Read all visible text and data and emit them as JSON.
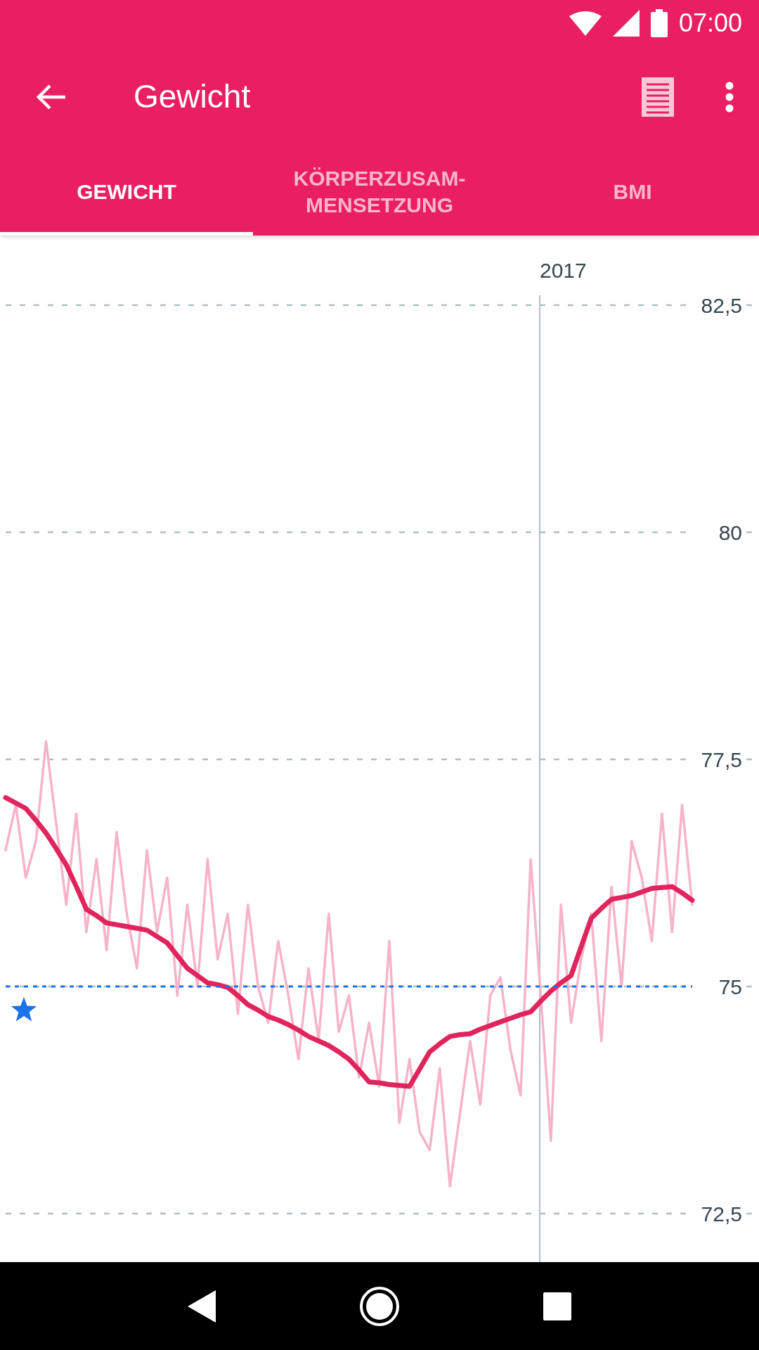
{
  "status_bar": {
    "time": "07:00"
  },
  "toolbar": {
    "title": "Gewicht"
  },
  "tabs": [
    {
      "label": "GEWICHT",
      "selected": true
    },
    {
      "label": "KÖRPERZUSAM-MENSETZUNG",
      "selected": false
    },
    {
      "label": "BMI",
      "selected": false
    }
  ],
  "chart": {
    "chart_data": {
      "type": "line",
      "grid": true,
      "yticks": [
        {
          "value": 82.5,
          "label": "82,5"
        },
        {
          "value": 80,
          "label": "80"
        },
        {
          "value": 77.5,
          "label": "77,5"
        },
        {
          "value": 75,
          "label": "75"
        },
        {
          "value": 72.5,
          "label": "72,5"
        }
      ],
      "series": [
        {
          "color": "#f6b3ca",
          "values": [
            76.5,
            77.0,
            76.2,
            76.6,
            77.7,
            76.8,
            75.9,
            76.9,
            75.6,
            76.4,
            75.4,
            76.7,
            75.8,
            75.2,
            76.5,
            75.6,
            76.2,
            74.9,
            75.9,
            75.0,
            76.4,
            75.3,
            75.8,
            74.7,
            75.9,
            75.0,
            74.6,
            75.5,
            74.9,
            74.2,
            75.2,
            74.4,
            75.8,
            74.5,
            74.9,
            74.0,
            74.6,
            73.9,
            75.5,
            73.5,
            74.2,
            73.4,
            73.2,
            74.1,
            72.8,
            73.6,
            74.4,
            73.7,
            74.9,
            75.1,
            74.3,
            73.8,
            76.4,
            74.9,
            73.3,
            75.9,
            74.6,
            75.3,
            75.8,
            74.4,
            76.1,
            75.0,
            76.6,
            76.2,
            75.5,
            76.9,
            75.6,
            77.0,
            75.9
          ]
        },
        {
          "color": "#e0245e",
          "values": [
            77.08,
            77.02,
            76.96,
            76.83,
            76.69,
            76.52,
            76.34,
            76.1,
            75.85,
            75.78,
            75.7,
            75.68,
            75.66,
            75.64,
            75.62,
            75.55,
            75.48,
            75.34,
            75.2,
            75.12,
            75.04,
            75.02,
            74.99,
            74.9,
            74.8,
            74.74,
            74.67,
            74.63,
            74.58,
            74.52,
            74.45,
            74.4,
            74.35,
            74.28,
            74.2,
            74.08,
            73.95,
            73.94,
            73.92,
            73.91,
            73.9,
            74.09,
            74.28,
            74.37,
            74.45,
            74.47,
            74.48,
            74.53,
            74.57,
            74.61,
            74.65,
            74.69,
            74.72,
            74.84,
            74.95,
            75.04,
            75.12,
            75.44,
            75.75,
            75.86,
            75.96,
            75.98,
            76.0,
            76.04,
            76.08,
            76.09,
            76.1,
            76.03,
            75.95
          ]
        },
        {
          "color": "#1a73e8",
          "line_style": "dotted",
          "values": [
            75,
            75,
            75,
            75,
            75,
            75,
            75,
            75,
            75,
            75,
            75,
            75,
            75,
            75,
            75,
            75,
            75,
            75,
            75,
            75,
            75,
            75,
            75,
            75,
            75,
            75,
            75,
            75,
            75,
            75,
            75,
            75,
            75,
            75,
            75,
            75,
            75,
            75,
            75,
            75,
            75,
            75,
            75,
            75,
            75,
            75,
            75,
            75,
            75,
            75,
            75,
            75,
            75,
            75,
            75,
            75,
            75,
            75,
            75,
            75,
            75,
            75,
            75,
            75,
            75,
            75,
            75,
            75,
            75
          ]
        }
      ],
      "ylim": [
        72.5,
        82.5
      ],
      "annotations": [
        "2017"
      ]
    }
  }
}
